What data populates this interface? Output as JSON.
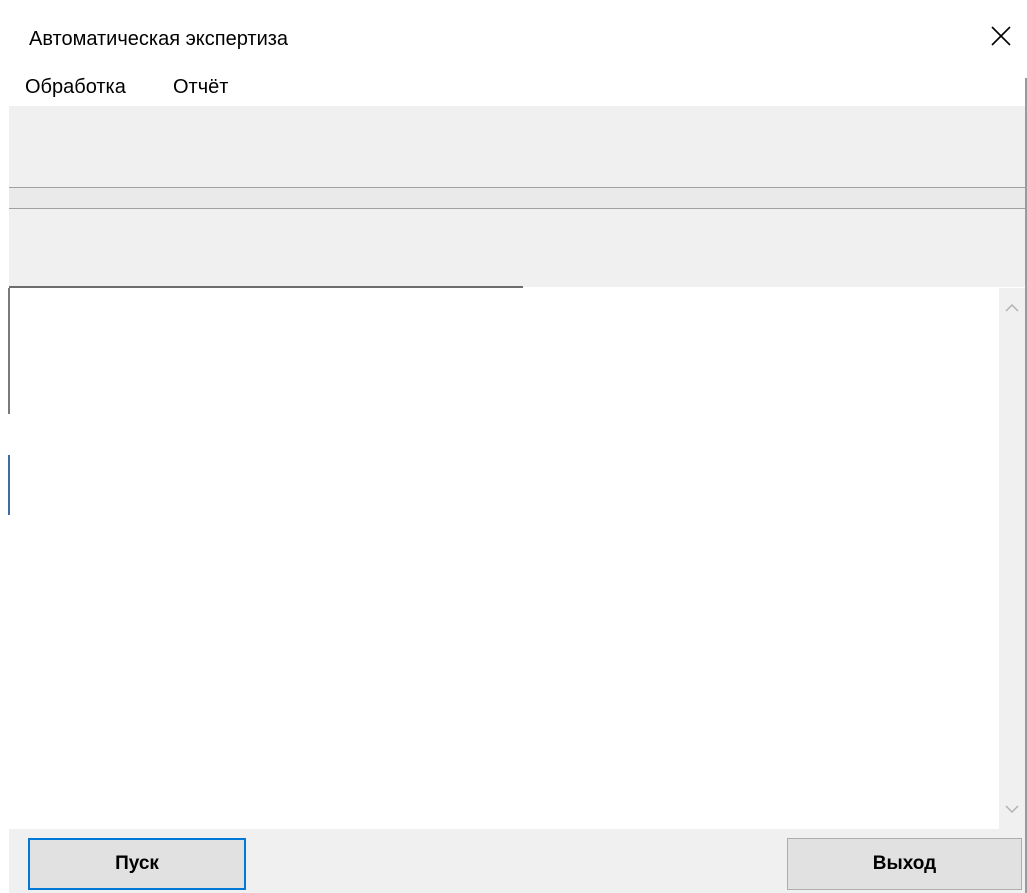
{
  "window": {
    "title": "Автоматическая экспертиза",
    "close_icon": "close-icon"
  },
  "menu": {
    "items": [
      {
        "label": "Обработка"
      },
      {
        "label": "Отчёт"
      }
    ]
  },
  "log": {
    "value": ""
  },
  "scrollbar": {
    "up_icon": "chevron-up-icon",
    "down_icon": "chevron-down-icon"
  },
  "buttons": {
    "start_label": "Пуск",
    "exit_label": "Выход"
  },
  "colors": {
    "focus_accent": "#0078d7",
    "panel_background": "#f0f0f0",
    "button_face": "#e1e1e1"
  }
}
